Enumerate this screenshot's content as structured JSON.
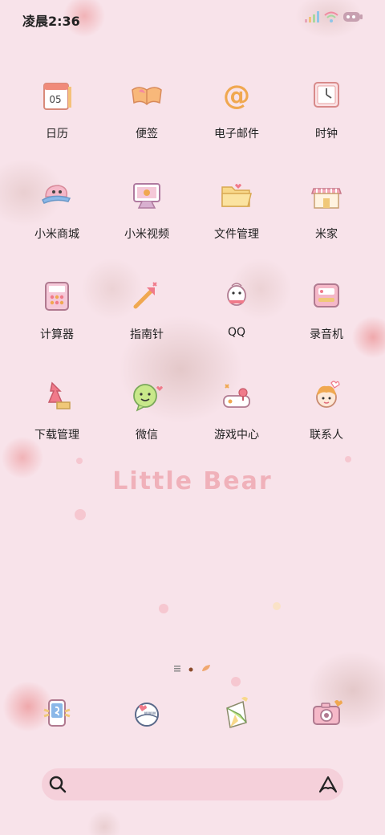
{
  "status_bar": {
    "time": "凌晨2:36"
  },
  "wallpaper": {
    "slogan": "Little Bear"
  },
  "apps": [
    {
      "label": "日历",
      "icon": "calendar-icon",
      "icon_text": "05"
    },
    {
      "label": "便签",
      "icon": "notes-icon"
    },
    {
      "label": "电子邮件",
      "icon": "email-icon",
      "icon_text": "@"
    },
    {
      "label": "时钟",
      "icon": "clock-icon"
    },
    {
      "label": "小米商城",
      "icon": "mi-store-icon"
    },
    {
      "label": "小米视频",
      "icon": "mi-video-icon"
    },
    {
      "label": "文件管理",
      "icon": "file-manager-icon"
    },
    {
      "label": "米家",
      "icon": "mi-home-icon"
    },
    {
      "label": "计算器",
      "icon": "calculator-icon"
    },
    {
      "label": "指南针",
      "icon": "compass-icon"
    },
    {
      "label": "QQ",
      "icon": "qq-icon"
    },
    {
      "label": "录音机",
      "icon": "recorder-icon"
    },
    {
      "label": "下载管理",
      "icon": "download-manager-icon"
    },
    {
      "label": "微信",
      "icon": "wechat-icon"
    },
    {
      "label": "游戏中心",
      "icon": "game-center-icon"
    },
    {
      "label": "联系人",
      "icon": "contacts-icon"
    }
  ],
  "dock": [
    {
      "icon": "phone-icon"
    },
    {
      "icon": "browser-icon",
      "icon_text": "www"
    },
    {
      "icon": "messages-icon"
    },
    {
      "icon": "camera-icon"
    }
  ],
  "page_indicator": {
    "current_page": 1,
    "page_count": 2
  },
  "search_bar": {
    "placeholder": ""
  },
  "colors": {
    "background": "#f8e3ea",
    "accent_pink": "#f08a9a",
    "accent_orange": "#f0a850",
    "text": "#222222"
  }
}
